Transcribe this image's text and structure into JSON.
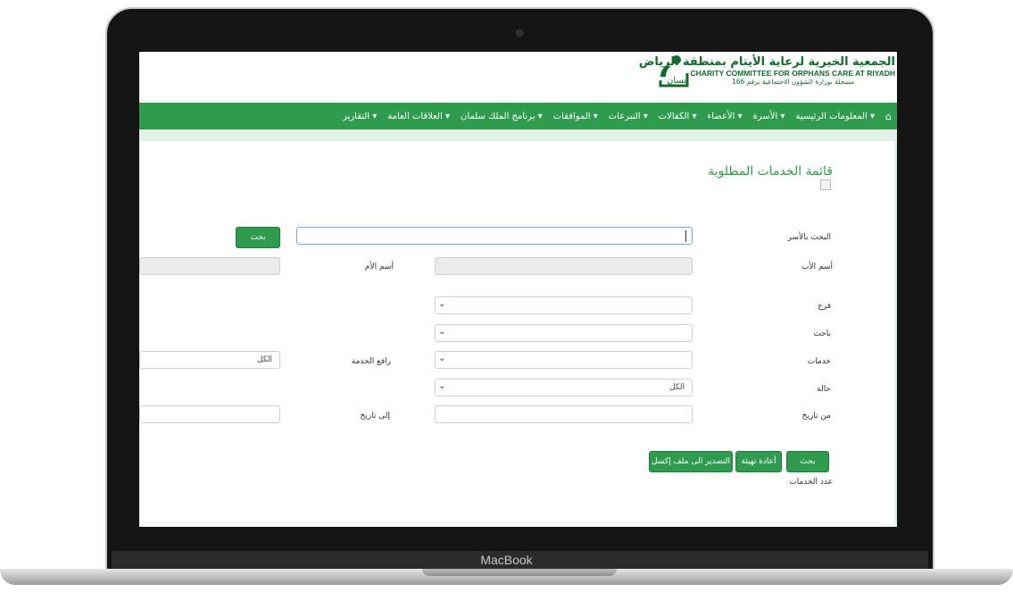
{
  "device": {
    "brand": "MacBook"
  },
  "header": {
    "org_name_ar": "الجمعية الخيرية لرعاية الأيتام بمنطقة الرياض",
    "org_name_en": "CHARITY COMMITTEE FOR ORPHANS CARE AT RIYADH",
    "registration": "مسجلة بوزارة الشؤون الاجتماعية برقم 166",
    "logo_text": "إنسان"
  },
  "nav": {
    "items": [
      "المعلومات الرئيسية",
      "الأسرة",
      "الأعضاء",
      "الكفالات",
      "التبرعات",
      "الموافقات",
      "برنامج الملك سلمان",
      "العلاقات العامة",
      "التقارير"
    ]
  },
  "page": {
    "title": "قائمة الخدمات المطلوبة"
  },
  "form": {
    "search_family_label": "البحث بالأسر",
    "search_value": "",
    "search_button": "بحث",
    "father_name_label": "أسم الأب",
    "mother_name_label": "أسم الأم",
    "branch_label": "فرع",
    "researcher_label": "باحث",
    "services_label": "خدمات",
    "service_submitter_label": "رافع الخدمة",
    "service_submitter_value": "الكل",
    "status_label": "حالة",
    "status_value": "الكل",
    "from_date_label": "من تاريخ",
    "to_date_label": "إلى تاريخ"
  },
  "actions": {
    "search": "بحث",
    "reset": "أعادة تهيئة",
    "export": "التصدير الى ملف إكسل",
    "count_label": "عدد الخدمات"
  },
  "colors": {
    "nav_green": "#2e9b4e",
    "brand_green": "#146b2e"
  }
}
